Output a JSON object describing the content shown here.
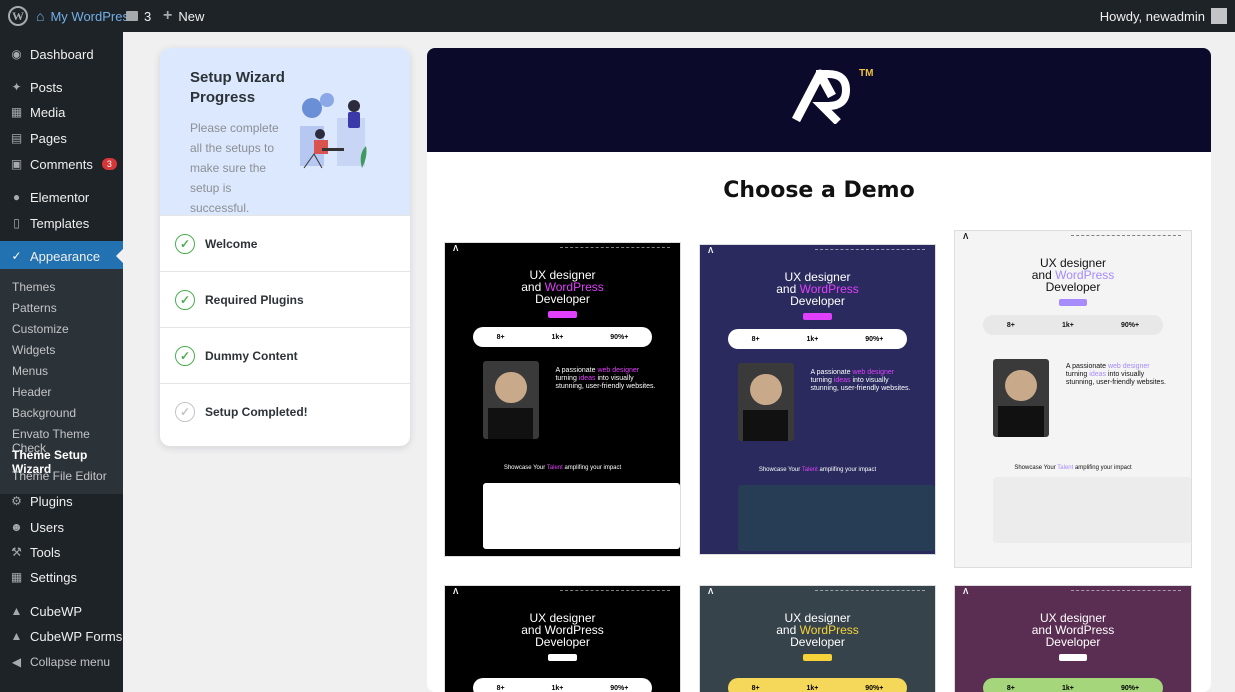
{
  "adminbar": {
    "site_name": "My WordPress",
    "comments_count": "3",
    "new_label": "New",
    "howdy": "Howdy, newadmin"
  },
  "sidebar": {
    "items": [
      {
        "label": "Dashboard",
        "icon": "dashboard-icon"
      },
      {
        "label": "Posts",
        "icon": "pin-icon"
      },
      {
        "label": "Media",
        "icon": "media-icon"
      },
      {
        "label": "Pages",
        "icon": "page-icon"
      },
      {
        "label": "Comments",
        "icon": "comment-icon",
        "badge": "3"
      },
      {
        "label": "Elementor",
        "icon": "elementor-icon"
      },
      {
        "label": "Templates",
        "icon": "folder-icon"
      },
      {
        "label": "Appearance",
        "icon": "brush-icon"
      },
      {
        "label": "Plugins",
        "icon": "plugin-icon"
      },
      {
        "label": "Users",
        "icon": "user-icon"
      },
      {
        "label": "Tools",
        "icon": "wrench-icon"
      },
      {
        "label": "Settings",
        "icon": "settings-icon"
      },
      {
        "label": "CubeWP",
        "icon": "cube-icon"
      },
      {
        "label": "CubeWP Forms",
        "icon": "cube-icon"
      },
      {
        "label": "Collapse menu",
        "icon": "collapse-icon"
      }
    ],
    "submenu": [
      "Themes",
      "Patterns",
      "Customize",
      "Widgets",
      "Menus",
      "Header",
      "Background",
      "Envato Theme Check",
      "Theme Setup Wizard",
      "Theme File Editor"
    ]
  },
  "wizard": {
    "title": "Setup Wizard Progress",
    "description": "Please complete all the setups to make sure the setup is successful.",
    "steps": [
      {
        "label": "Welcome",
        "status": "done"
      },
      {
        "label": "Required Plugins",
        "status": "done"
      },
      {
        "label": "Dummy Content",
        "status": "done"
      },
      {
        "label": "Setup Completed!",
        "status": "pending"
      }
    ]
  },
  "demo": {
    "logo_tm": "TM",
    "title": "Choose a Demo",
    "hero_line1": "UX designer",
    "hero_and": "and",
    "hero_wp": "WordPress",
    "hero_dev": "Developer",
    "stats": [
      "8+",
      "1k+",
      "90%+"
    ],
    "about_a": "A passionate",
    "about_web": "web designer",
    "about_b": "turning",
    "about_ideas": "ideas",
    "about_c": "into visually",
    "about_d": "stunning, user-friendly websites.",
    "showcase_a": "Showcase Your",
    "showcase_talent": "Talent",
    "showcase_b": "amplifing your impact",
    "cards": [
      {
        "bg": "#000000",
        "text": "#ffffff",
        "accent": "#e040fb",
        "pill": "#ffffff",
        "pilltext": "#000000"
      },
      {
        "bg": "#2a2a5e",
        "text": "#ffffff",
        "accent": "#e040fb",
        "pill": "#ffffff",
        "pilltext": "#000000"
      },
      {
        "bg": "#f4f4f4",
        "text": "#111111",
        "accent": "#a78bfa",
        "pill": "#e8e8e8",
        "pilltext": "#111111"
      },
      {
        "bg": "#000000",
        "text": "#ffffff",
        "accent": "#ffffff",
        "pill": "#ffffff",
        "pilltext": "#000000"
      },
      {
        "bg": "#37434b",
        "text": "#ffffff",
        "accent": "#f5d23a",
        "pill": "#f5d75a",
        "pilltext": "#000000"
      },
      {
        "bg": "#5a2d52",
        "text": "#ffffff",
        "accent": "#ffffff",
        "pill": "#a5d67c",
        "pilltext": "#000000"
      }
    ]
  }
}
